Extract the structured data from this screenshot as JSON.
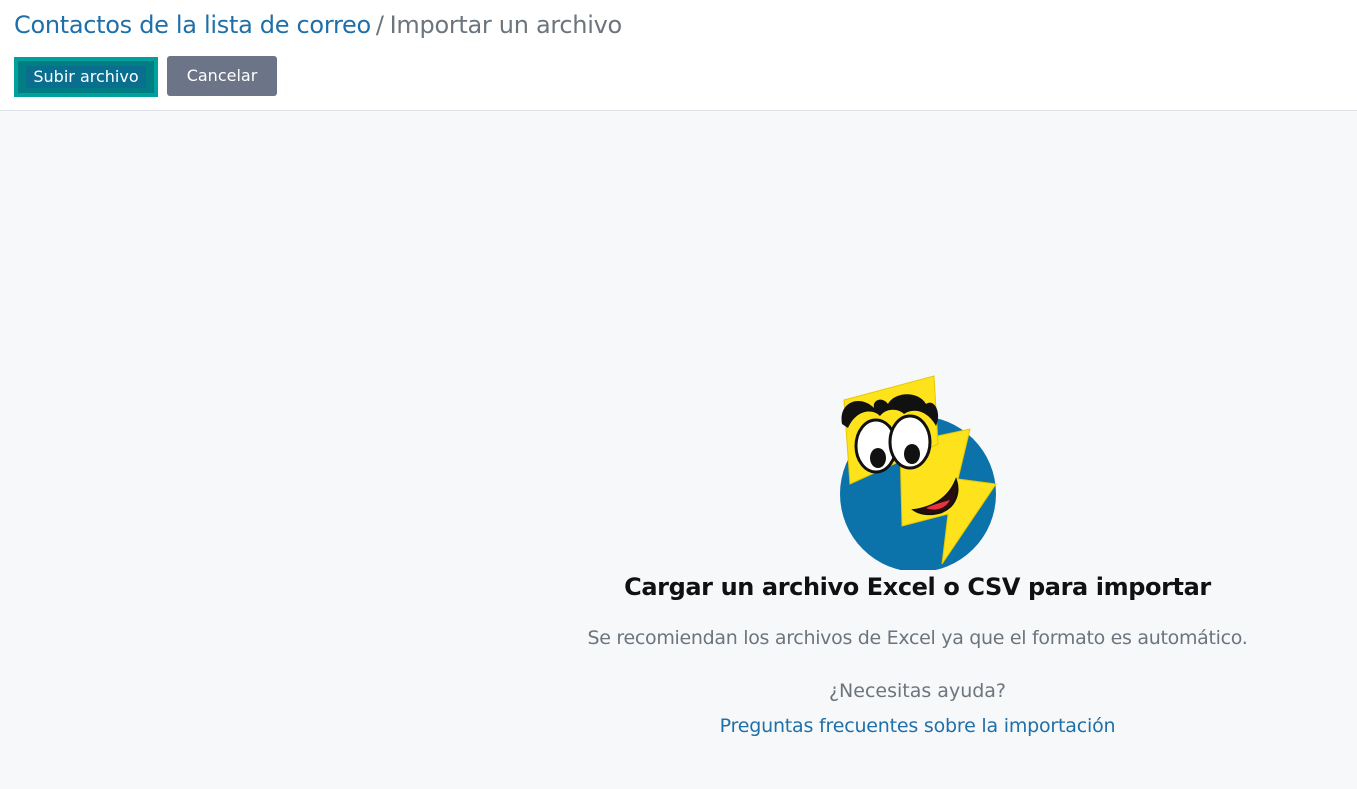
{
  "breadcrumb": {
    "parent": "Contactos de la lista de correo",
    "separator": "/",
    "current": "Importar un archivo"
  },
  "toolbar": {
    "upload_label": "Subir archivo",
    "cancel_label": "Cancelar"
  },
  "empty_state": {
    "mascot_icon": "smiling-lightning-mascot-icon",
    "title": "Cargar un archivo Excel o CSV para importar",
    "description": "Se recomiendan los archivos de Excel ya que el formato es automático.",
    "help_question": "¿Necesitas ayuda?",
    "help_link": "Preguntas frecuentes sobre la importación"
  },
  "colors": {
    "link": "#1f6fa8",
    "upload_button": "#017e84",
    "cancel_button": "#6c7588",
    "background": "#f7f8fa",
    "mascot_blue": "#0b73aa",
    "mascot_yellow": "#fde21c"
  }
}
